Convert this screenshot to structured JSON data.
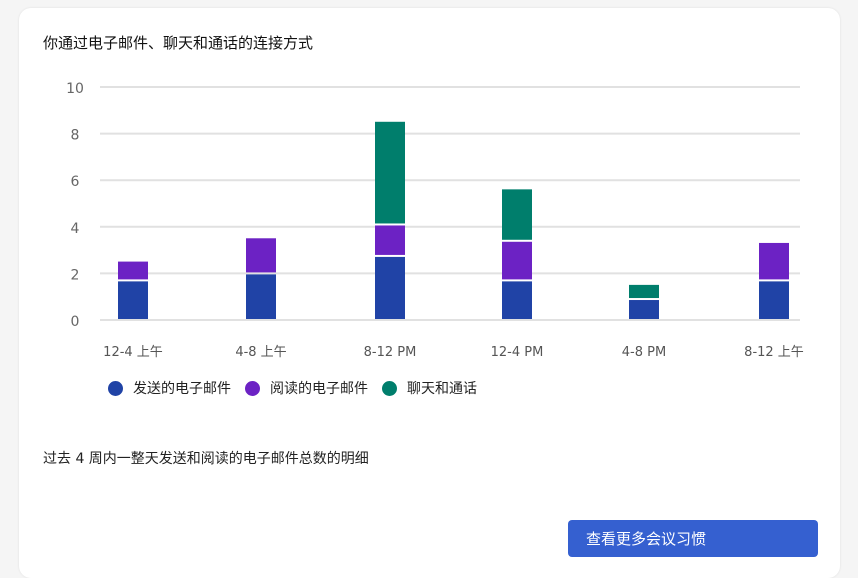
{
  "card": {
    "title": "你通过电子邮件、聊天和通话的连接方式",
    "description": "过去 4 周内一整天发送和阅读的电子邮件总数的明细",
    "button_label": "查看更多会议习惯"
  },
  "chart_data": {
    "type": "bar",
    "stacked": true,
    "categories": [
      "12-4 上午",
      "4-8 上午",
      "8-12 PM",
      "12-4 PM",
      "4-8 PM",
      "8-12 上午"
    ],
    "series": [
      {
        "name": "发送的电子邮件",
        "color": "#2043a6",
        "values": [
          1.7,
          2.0,
          2.75,
          1.7,
          0.9,
          1.7
        ]
      },
      {
        "name": "阅读的电子邮件",
        "color": "#6c22c4",
        "values": [
          0.85,
          1.55,
          1.35,
          1.7,
          0,
          1.65
        ]
      },
      {
        "name": "聊天和通话",
        "color": "#007e6c",
        "values": [
          0,
          0,
          4.45,
          2.25,
          0.65,
          0
        ]
      }
    ],
    "ylim": [
      0,
      10
    ],
    "yticks": [
      0,
      2,
      4,
      6,
      8,
      10
    ],
    "grid": true,
    "legend": "bottom-left"
  }
}
